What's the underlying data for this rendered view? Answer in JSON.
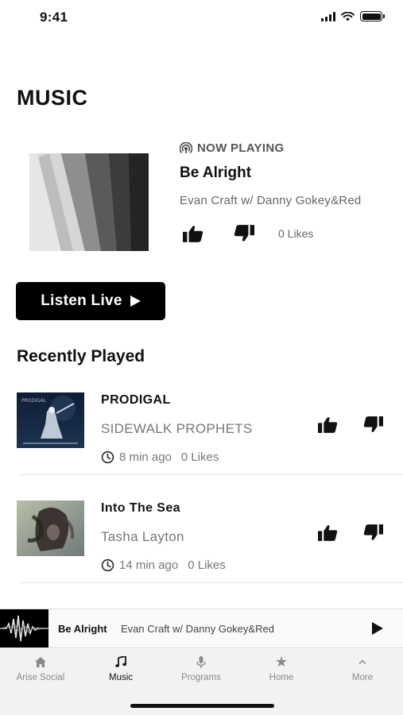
{
  "status_bar": {
    "time": "9:41"
  },
  "page": {
    "title": "MUSIC"
  },
  "now_playing": {
    "label": "NOW PLAYING",
    "title": "Be Alright",
    "artist": "Evan Craft w/ Danny Gokey&Red",
    "likes": "0 Likes"
  },
  "listen_live": {
    "label": "Listen Live"
  },
  "recently_played": {
    "title": "Recently Played",
    "tracks": [
      {
        "title": "PRODIGAL",
        "artist": "SIDEWALK PROPHETS",
        "time": "8 min ago",
        "likes": "0 Likes"
      },
      {
        "title": "Into The Sea",
        "artist": "Tasha Layton",
        "time": "14 min ago",
        "likes": "0 Likes"
      }
    ]
  },
  "mini_player": {
    "title": "Be Alright",
    "artist": "Evan Craft w/ Danny Gokey&Red"
  },
  "tab_bar": {
    "active": "Music",
    "items": [
      {
        "label": "Arise Social",
        "icon": "home-icon"
      },
      {
        "label": "Music",
        "icon": "music-note-icon"
      },
      {
        "label": "Programs",
        "icon": "microphone-icon"
      },
      {
        "label": "Home",
        "icon": "star-icon"
      },
      {
        "label": "More",
        "icon": "chevron-up-icon"
      }
    ]
  },
  "colors": {
    "accent": "#000000",
    "text_muted": "#777777",
    "tab_bar_bg": "#f2f2f2"
  }
}
